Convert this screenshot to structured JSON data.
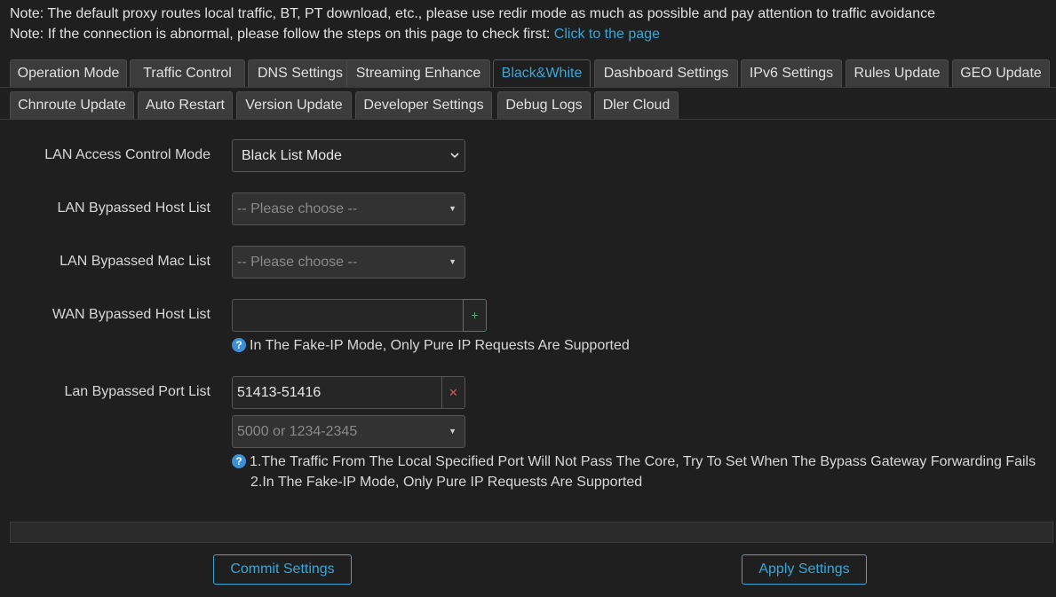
{
  "notes": {
    "note1": "Note: The default proxy routes local traffic, BT, PT download, etc., please use redir mode as much as possible and pay attention to traffic avoidance",
    "note2_prefix": "Note: If the connection is abnormal, please follow the steps on this page to check first: ",
    "note2_link": "Click to the page"
  },
  "tabs": {
    "row1": [
      {
        "label": "Operation Mode"
      },
      {
        "label": "Traffic Control"
      },
      {
        "label": "DNS Settings"
      },
      {
        "label": "Streaming Enhance"
      },
      {
        "label": "Black&White"
      },
      {
        "label": "Dashboard Settings"
      },
      {
        "label": "IPv6 Settings"
      },
      {
        "label": "Rules Update"
      },
      {
        "label": "GEO Update"
      }
    ],
    "row2": [
      {
        "label": "Chnroute Update"
      },
      {
        "label": "Auto Restart"
      },
      {
        "label": "Version Update"
      },
      {
        "label": "Developer Settings"
      },
      {
        "label": "Debug Logs"
      },
      {
        "label": "Dler Cloud"
      }
    ],
    "active": "Black&White"
  },
  "form": {
    "lan_access_mode": {
      "label": "LAN Access Control Mode",
      "value": "Black List Mode"
    },
    "lan_host_list": {
      "label": "LAN Bypassed Host List",
      "placeholder": "-- Please choose --"
    },
    "lan_mac_list": {
      "label": "LAN Bypassed Mac List",
      "placeholder": "-- Please choose --"
    },
    "wan_host_list": {
      "label": "WAN Bypassed Host List",
      "value": "",
      "add_icon": "plus",
      "help": "In The Fake-IP Mode, Only Pure IP Requests Are Supported"
    },
    "lan_port_list": {
      "label": "Lan Bypassed Port List",
      "value": "51413-51416",
      "remove_icon": "times",
      "placeholder": "5000 or 1234-2345",
      "help_line1": "1.The Traffic From The Local Specified Port Will Not Pass The Core, Try To Set When The Bypass Gateway Forwarding Fails",
      "help_line2": "2.In The Fake-IP Mode, Only Pure IP Requests Are Supported"
    }
  },
  "actions": {
    "commit": "Commit Settings",
    "apply": "Apply Settings"
  },
  "colors": {
    "background": "#1f1f1f",
    "accent": "#3aa6d6",
    "tab_bg": "#3c3c3c",
    "add_green": "#2fbf6a",
    "remove_red": "#d9534f"
  }
}
